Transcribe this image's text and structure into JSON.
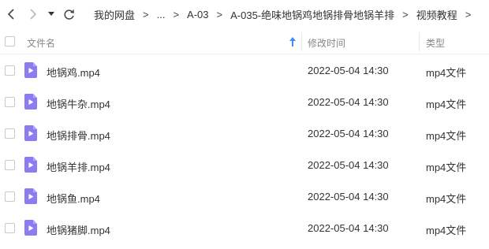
{
  "breadcrumb": {
    "items": [
      "我的网盘",
      "...",
      "A-03",
      "A-035-绝味地锅鸡地锅排骨地锅羊排",
      "视频教程"
    ],
    "separator": ">"
  },
  "header": {
    "name": "文件名",
    "modified": "修改时间",
    "type": "类型"
  },
  "files": [
    {
      "name": "地锅鸡.mp4",
      "modified": "2022-05-04 14:30",
      "type": "mp4文件"
    },
    {
      "name": "地锅牛杂.mp4",
      "modified": "2022-05-04 14:30",
      "type": "mp4文件"
    },
    {
      "name": "地锅排骨.mp4",
      "modified": "2022-05-04 14:30",
      "type": "mp4文件"
    },
    {
      "name": "地锅羊排.mp4",
      "modified": "2022-05-04 14:30",
      "type": "mp4文件"
    },
    {
      "name": "地锅鱼.mp4",
      "modified": "2022-05-04 14:30",
      "type": "mp4文件"
    },
    {
      "name": "地锅猪脚.mp4",
      "modified": "2022-05-04 14:30",
      "type": "mp4文件"
    }
  ],
  "icons": {
    "back": "chevron-left-icon",
    "forward": "chevron-right-icon",
    "history": "caret-down-icon",
    "refresh": "refresh-icon",
    "sort": "sort-up-arrow-icon",
    "file": "video-file-icon"
  },
  "colors": {
    "video_icon": "#8b7cf0",
    "sort_arrow": "#3b8ff0"
  }
}
